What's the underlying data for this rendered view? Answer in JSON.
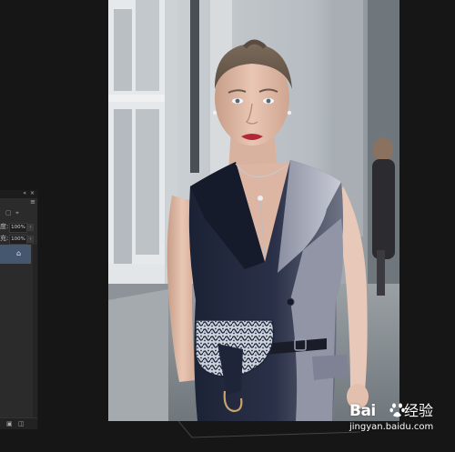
{
  "layers_panel": {
    "title_buttons": "« ×",
    "menu_icon": "≡",
    "lock_icons": [
      "lock-transparent-icon",
      "lock-move-icon"
    ],
    "opacity": {
      "label": "度:",
      "value": "100%"
    },
    "fill": {
      "label": "充:",
      "value": "100%"
    },
    "active_layer_icon": "layer-link-icon",
    "footer_icons": [
      "new-layer-icon",
      "delete-layer-icon"
    ]
  },
  "canvas": {
    "image": "photo-woman-in-navy-vest-dress",
    "colors": {
      "background": "#161616",
      "panel": "#2b2b2b",
      "selected_layer": "#45576f"
    }
  },
  "watermark": {
    "logo_text": "Bai",
    "logo_suffix": "经验",
    "url": "jingyan.baidu.com"
  }
}
